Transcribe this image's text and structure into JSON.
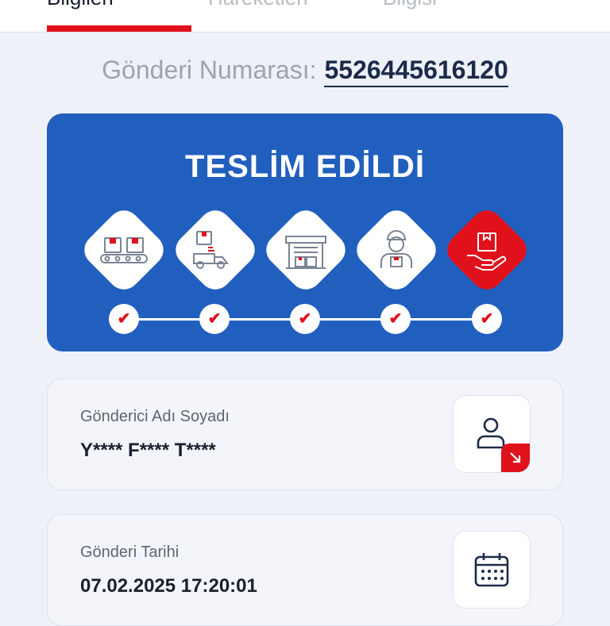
{
  "tabs": [
    {
      "label": "Bilgileri"
    },
    {
      "label": "Hareketleri"
    },
    {
      "label": "Bilgisi"
    }
  ],
  "tracking": {
    "label": "Gönderi Numarası:",
    "number": "5526445616120"
  },
  "status": {
    "title": "TESLİM EDİLDİ",
    "steps": [
      {
        "icon": "conveyor-packages-icon",
        "completed": true
      },
      {
        "icon": "delivery-truck-icon",
        "completed": true
      },
      {
        "icon": "warehouse-icon",
        "completed": true
      },
      {
        "icon": "courier-icon",
        "completed": true
      },
      {
        "icon": "hand-package-icon",
        "completed": true,
        "current": true
      }
    ]
  },
  "sender": {
    "label": "Gönderici Adı Soyadı",
    "value": "Y**** F**** T****",
    "icon": "user-icon"
  },
  "shipment_date": {
    "label": "Gönderi Tarihi",
    "value": "07.02.2025 17:20:01",
    "icon": "calendar-icon"
  },
  "colors": {
    "brand_red": "#e0111b",
    "status_blue": "#215fbf",
    "navy": "#1c2b4a"
  }
}
